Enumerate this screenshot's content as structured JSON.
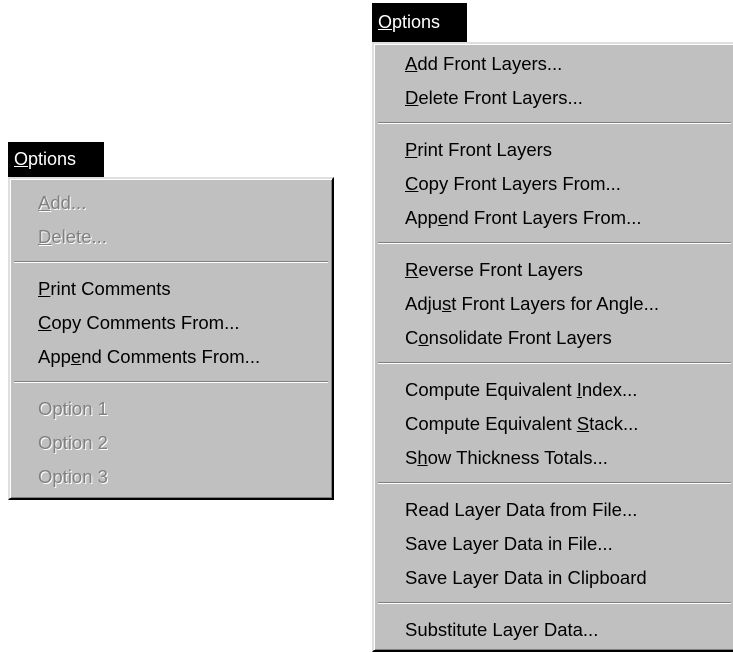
{
  "menus": [
    {
      "id": "left",
      "title": "Options",
      "title_accel": 0,
      "items": [
        {
          "label": "Add...",
          "accel": 0,
          "disabled": true
        },
        {
          "label": "Delete...",
          "accel": 0,
          "disabled": true
        },
        {
          "separator": true
        },
        {
          "label": "Print Comments",
          "accel": 0,
          "disabled": false
        },
        {
          "label": "Copy Comments From...",
          "accel": 0,
          "disabled": false
        },
        {
          "label": "Append Comments From...",
          "accel": 3,
          "disabled": false
        },
        {
          "separator": true
        },
        {
          "label": "Option 1",
          "accel": -1,
          "disabled": true
        },
        {
          "label": "Option 2",
          "accel": -1,
          "disabled": true
        },
        {
          "label": "Option 3",
          "accel": -1,
          "disabled": true
        }
      ]
    },
    {
      "id": "right",
      "title": "Options",
      "title_accel": 0,
      "items": [
        {
          "label": "Add Front Layers...",
          "accel": 0,
          "disabled": false
        },
        {
          "label": "Delete Front Layers...",
          "accel": 0,
          "disabled": false
        },
        {
          "separator": true
        },
        {
          "label": "Print Front Layers",
          "accel": 0,
          "disabled": false
        },
        {
          "label": "Copy Front Layers From...",
          "accel": 0,
          "disabled": false
        },
        {
          "label": "Append Front Layers From...",
          "accel": 3,
          "disabled": false
        },
        {
          "separator": true
        },
        {
          "label": "Reverse Front Layers",
          "accel": 0,
          "disabled": false
        },
        {
          "label": "Adjust Front Layers for Angle...",
          "accel": 4,
          "disabled": false
        },
        {
          "label": "Consolidate Front Layers",
          "accel": 1,
          "disabled": false
        },
        {
          "separator": true
        },
        {
          "label": "Compute Equivalent Index...",
          "accel": 19,
          "disabled": false
        },
        {
          "label": "Compute Equivalent Stack...",
          "accel": 19,
          "disabled": false
        },
        {
          "label": "Show Thickness Totals...",
          "accel": 1,
          "disabled": false
        },
        {
          "separator": true
        },
        {
          "label": "Read Layer Data from File...",
          "accel": -1,
          "disabled": false
        },
        {
          "label": "Save Layer Data in File...",
          "accel": -1,
          "disabled": false
        },
        {
          "label": "Save Layer Data in Clipboard",
          "accel": -1,
          "disabled": false
        },
        {
          "separator": true
        },
        {
          "label": "Substitute Layer Data...",
          "accel": -1,
          "disabled": false
        }
      ]
    }
  ]
}
